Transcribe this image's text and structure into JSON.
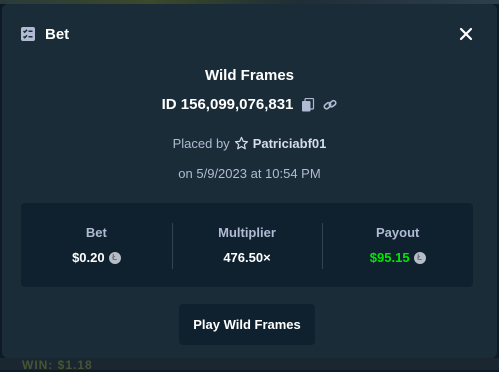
{
  "header": {
    "title": "Bet"
  },
  "bet": {
    "game_name": "Wild Frames",
    "id_text": "ID 156,099,076,831",
    "placed_by_label": "Placed by",
    "username": "Patriciabf01",
    "date_text": "on 5/9/2023 at 10:54 PM"
  },
  "stats": {
    "bet_label": "Bet",
    "bet_value": "$0.20",
    "multiplier_label": "Multiplier",
    "multiplier_value": "476.50×",
    "payout_label": "Payout",
    "payout_value": "$95.15"
  },
  "actions": {
    "play_label": "Play Wild Frames"
  },
  "colors": {
    "modal_bg": "#1a2c38",
    "panel_bg": "#0f212e",
    "payout_green": "#00e701",
    "muted_text": "#b1bad3"
  },
  "icons": {
    "title": "bet-slip-icon",
    "close": "close-icon",
    "copy": "copy-icon",
    "link": "link-icon",
    "star": "star-icon",
    "coin": "litecoin-icon"
  },
  "background": {
    "ghost_text": "WIN: $1.18"
  }
}
